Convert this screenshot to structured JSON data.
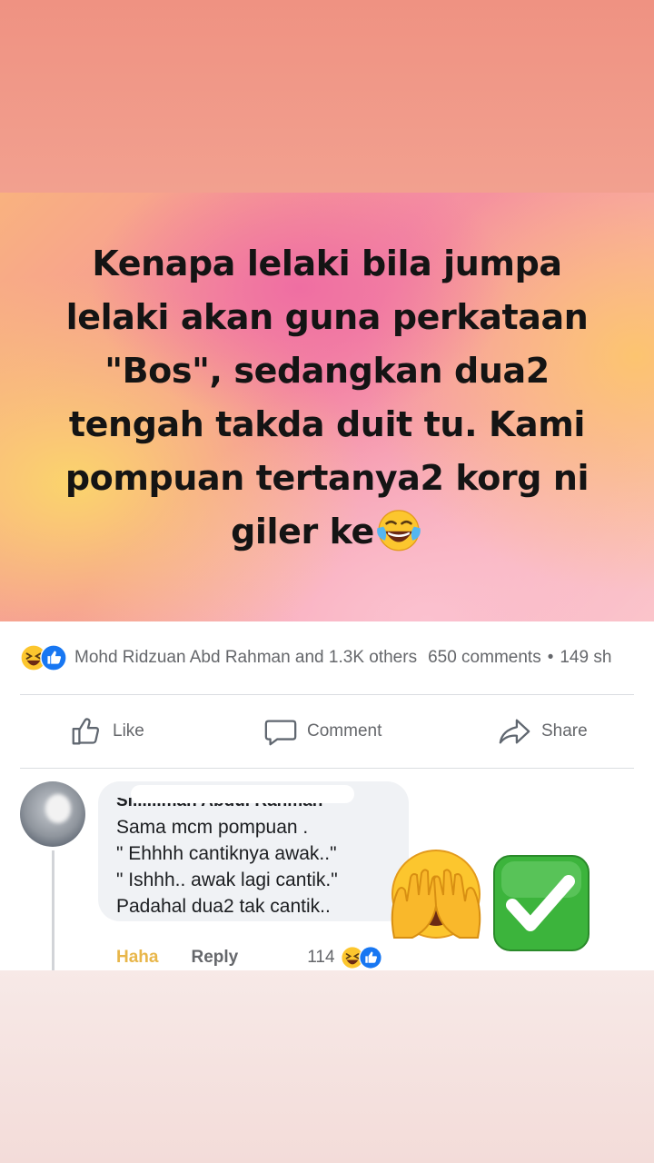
{
  "post": {
    "image_text_lines": [
      "Kenapa lelaki bila jumpa",
      "lelaki akan guna perkataan",
      "\"Bos\", sedangkan dua2",
      "tengah takda duit tu. Kami",
      "pompuan tertanya2 korg ni",
      "giler ke"
    ],
    "image_text_emoji": "laughing-tears-emoji"
  },
  "reactions": {
    "icons": [
      "haha-icon",
      "like-icon"
    ],
    "summary": "Mohd Ridzuan Abd Rahman and 1.3K others",
    "comments": "650 comments",
    "separator": "•",
    "shares": "149 sh"
  },
  "actions": {
    "like_label": "Like",
    "comment_label": "Comment",
    "share_label": "Share"
  },
  "comment": {
    "author": "Si......man Abdul Rahman",
    "lines": [
      "Sama mcm pompuan .",
      "\" Ehhhh cantiknya awak..\"",
      "\" Ishhh.. awak lagi cantik.\"",
      "Padahal dua2 tak cantik.."
    ],
    "reaction_label": "Haha",
    "reply_label": "Reply",
    "reaction_count": "114"
  },
  "overlay_emojis": [
    "face-with-hand-over-eyes-emoji",
    "check-mark-button-emoji"
  ],
  "colors": {
    "top_band": "#ef9282",
    "fb_gray_text": "#65676b",
    "haha_yellow": "#e8b64a",
    "like_blue": "#1877f2",
    "check_green": "#3cb43c"
  }
}
